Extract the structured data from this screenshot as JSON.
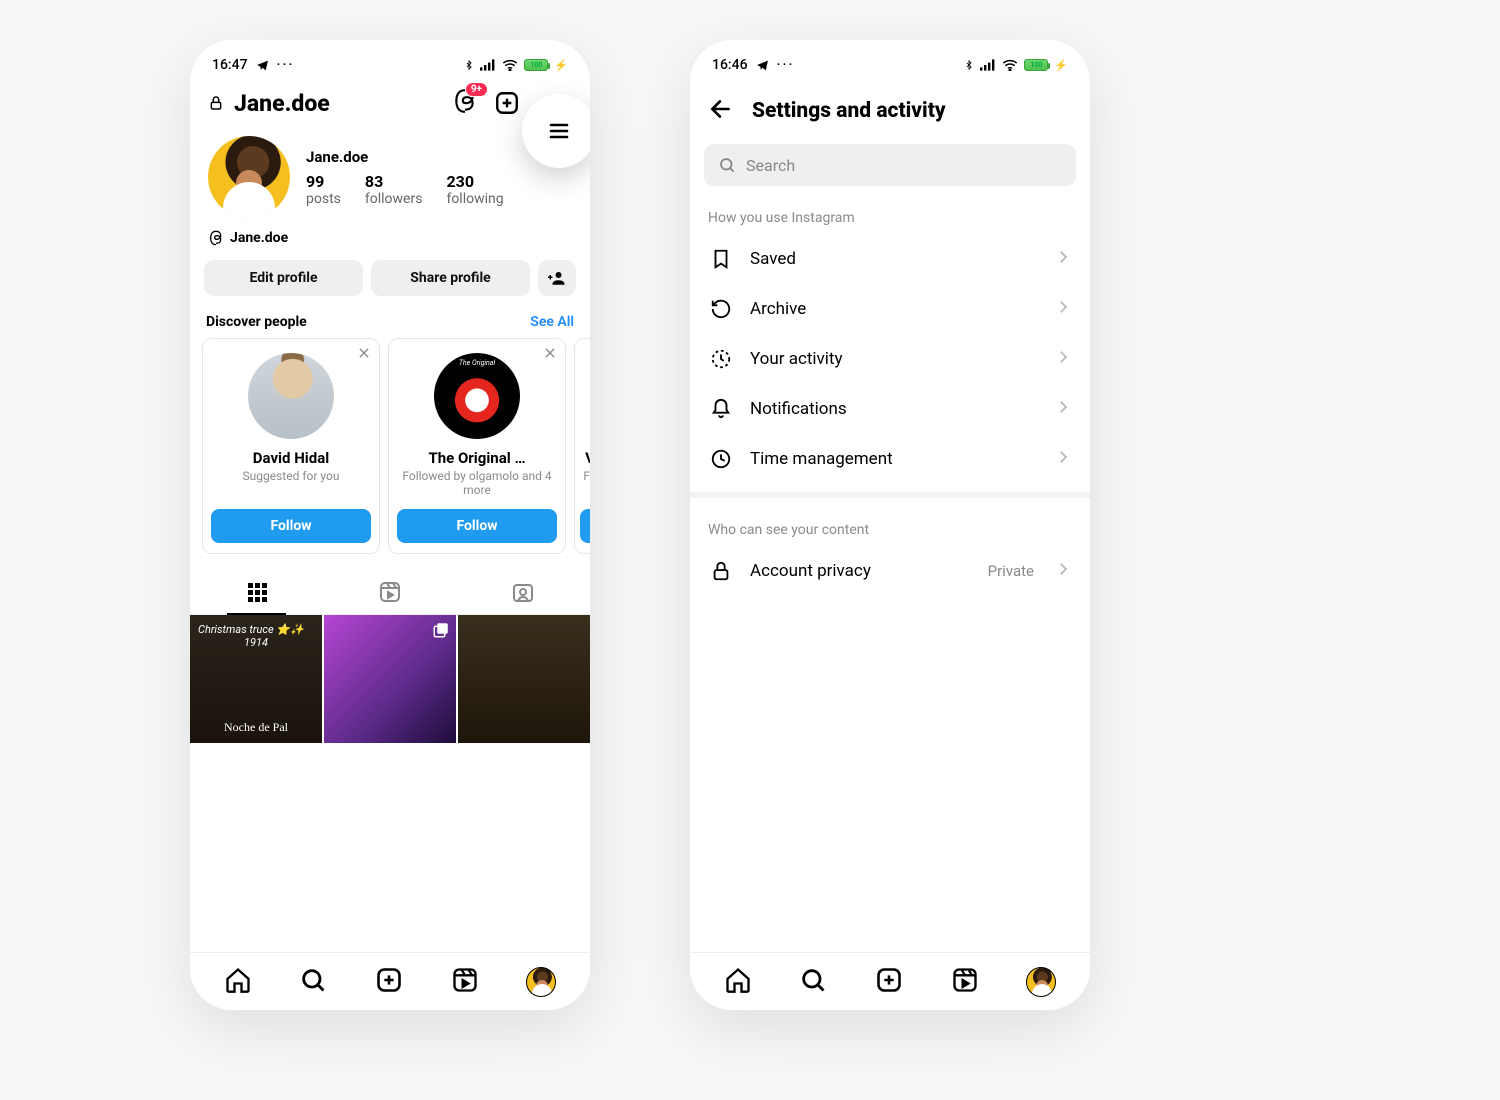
{
  "profile": {
    "status": {
      "time": "16:47",
      "battery": "100"
    },
    "username": "Jane.doe",
    "threads_badge": "9+",
    "stats": {
      "posts_n": "99",
      "posts_l": "posts",
      "followers_n": "83",
      "followers_l": "followers",
      "following_n": "230",
      "following_l": "following"
    },
    "threads_handle": "Jane.doe",
    "buttons": {
      "edit": "Edit profile",
      "share": "Share profile"
    },
    "discover": {
      "title": "Discover people",
      "see_all": "See All",
      "cards": [
        {
          "name": "David Hidal",
          "sub": "Suggested for you",
          "follow": "Follow"
        },
        {
          "name": "The Original …",
          "sub": "Followed by olgamolo and 4 more",
          "follow": "Follow"
        },
        {
          "name": "V",
          "sub": "Fo",
          "follow": ""
        }
      ]
    },
    "grid": {
      "tile0_line1": "Christmas truce ⭐✨",
      "tile0_line2": "1914",
      "tile0_brand": "Noche de Pal"
    }
  },
  "settings": {
    "status": {
      "time": "16:46",
      "battery": "100"
    },
    "title": "Settings and activity",
    "search_placeholder": "Search",
    "section_use": "How you use Instagram",
    "items_use": [
      {
        "label": "Saved"
      },
      {
        "label": "Archive"
      },
      {
        "label": "Your activity"
      },
      {
        "label": "Notifications"
      },
      {
        "label": "Time management"
      }
    ],
    "section_who": "Who can see your content",
    "privacy": {
      "label": "Account privacy",
      "value": "Private"
    }
  }
}
